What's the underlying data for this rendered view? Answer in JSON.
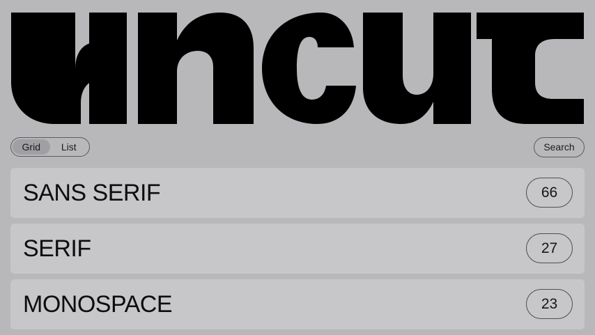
{
  "logo": {
    "text": "uncut",
    "color": "#000000"
  },
  "view_toggle": {
    "options": [
      {
        "label": "Grid",
        "selected": true
      },
      {
        "label": "List",
        "selected": false
      }
    ]
  },
  "search": {
    "label": "Search"
  },
  "categories": [
    {
      "name": "SANS SERIF",
      "count": "66"
    },
    {
      "name": "SERIF",
      "count": "27"
    },
    {
      "name": "MONOSPACE",
      "count": "23"
    }
  ],
  "colors": {
    "background": "#b8b7ba",
    "row_background": "#c7c6c9",
    "toggle_active": "#a09fa3",
    "border": "#5c5b5f"
  }
}
